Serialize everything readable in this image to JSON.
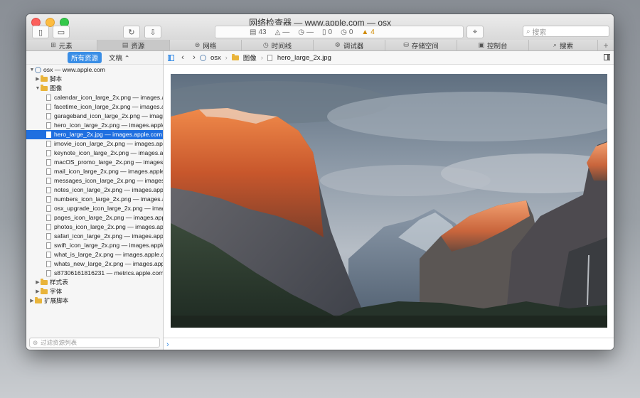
{
  "window": {
    "title": "网络检查器 — www.apple.com — osx"
  },
  "toolbar": {
    "resource_count": "43",
    "errors_count": "0",
    "warnings_dim_count": "0",
    "warnings_count": "4",
    "search_placeholder": "搜索"
  },
  "tabs": [
    {
      "label": "元素",
      "icon": "elements-icon"
    },
    {
      "label": "资源",
      "icon": "resources-icon",
      "active": true
    },
    {
      "label": "网络",
      "icon": "network-icon"
    },
    {
      "label": "时间线",
      "icon": "timeline-icon"
    },
    {
      "label": "调试器",
      "icon": "debugger-icon"
    },
    {
      "label": "存储空间",
      "icon": "storage-icon"
    },
    {
      "label": "控制台",
      "icon": "console-icon"
    },
    {
      "label": "搜索",
      "icon": "search-icon"
    }
  ],
  "sidebar": {
    "scope_all": "所有资源",
    "scope_doc": "文稿 ⌃",
    "root": "osx — www.apple.com",
    "folder_scripts": "脚本",
    "folder_images": "图像",
    "images": [
      "calendar_icon_large_2x.png — images.apple.com",
      "facetime_icon_large_2x.png — images.apple.com",
      "garageband_icon_large_2x.png — images.apple.com",
      "hero_icon_large_2x.png — images.apple.com",
      "hero_large_2x.jpg — images.apple.com",
      "imovie_icon_large_2x.png — images.apple.com",
      "keynote_icon_large_2x.png — images.apple.com",
      "macOS_promo_large_2x.png — images.apple.com",
      "mail_icon_large_2x.png — images.apple.com",
      "messages_icon_large_2x.png — images.apple.com",
      "notes_icon_large_2x.png — images.apple.com",
      "numbers_icon_large_2x.png — images.apple.com",
      "osx_upgrade_icon_large_2x.png — images.apple.com",
      "pages_icon_large_2x.png — images.apple.com",
      "photos_icon_large_2x.png — images.apple.com",
      "safari_icon_large_2x.png — images.apple.com",
      "swift_icon_large_2x.png — images.apple.com",
      "what_is_large_2x.png — images.apple.com",
      "whats_new_large_2x.png — images.apple.com",
      "s87306161816231 — metrics.apple.com"
    ],
    "selected_index": 4,
    "folder_styles": "样式表",
    "folder_fonts": "字体",
    "folder_extensions": "扩展脚本",
    "filter_placeholder": "过滤资源列表"
  },
  "breadcrumb": {
    "root": "osx",
    "folder": "图像",
    "file": "hero_large_2x.jpg"
  },
  "colors": {
    "accent": "#1f6fe0",
    "warning": "#d08a00"
  }
}
